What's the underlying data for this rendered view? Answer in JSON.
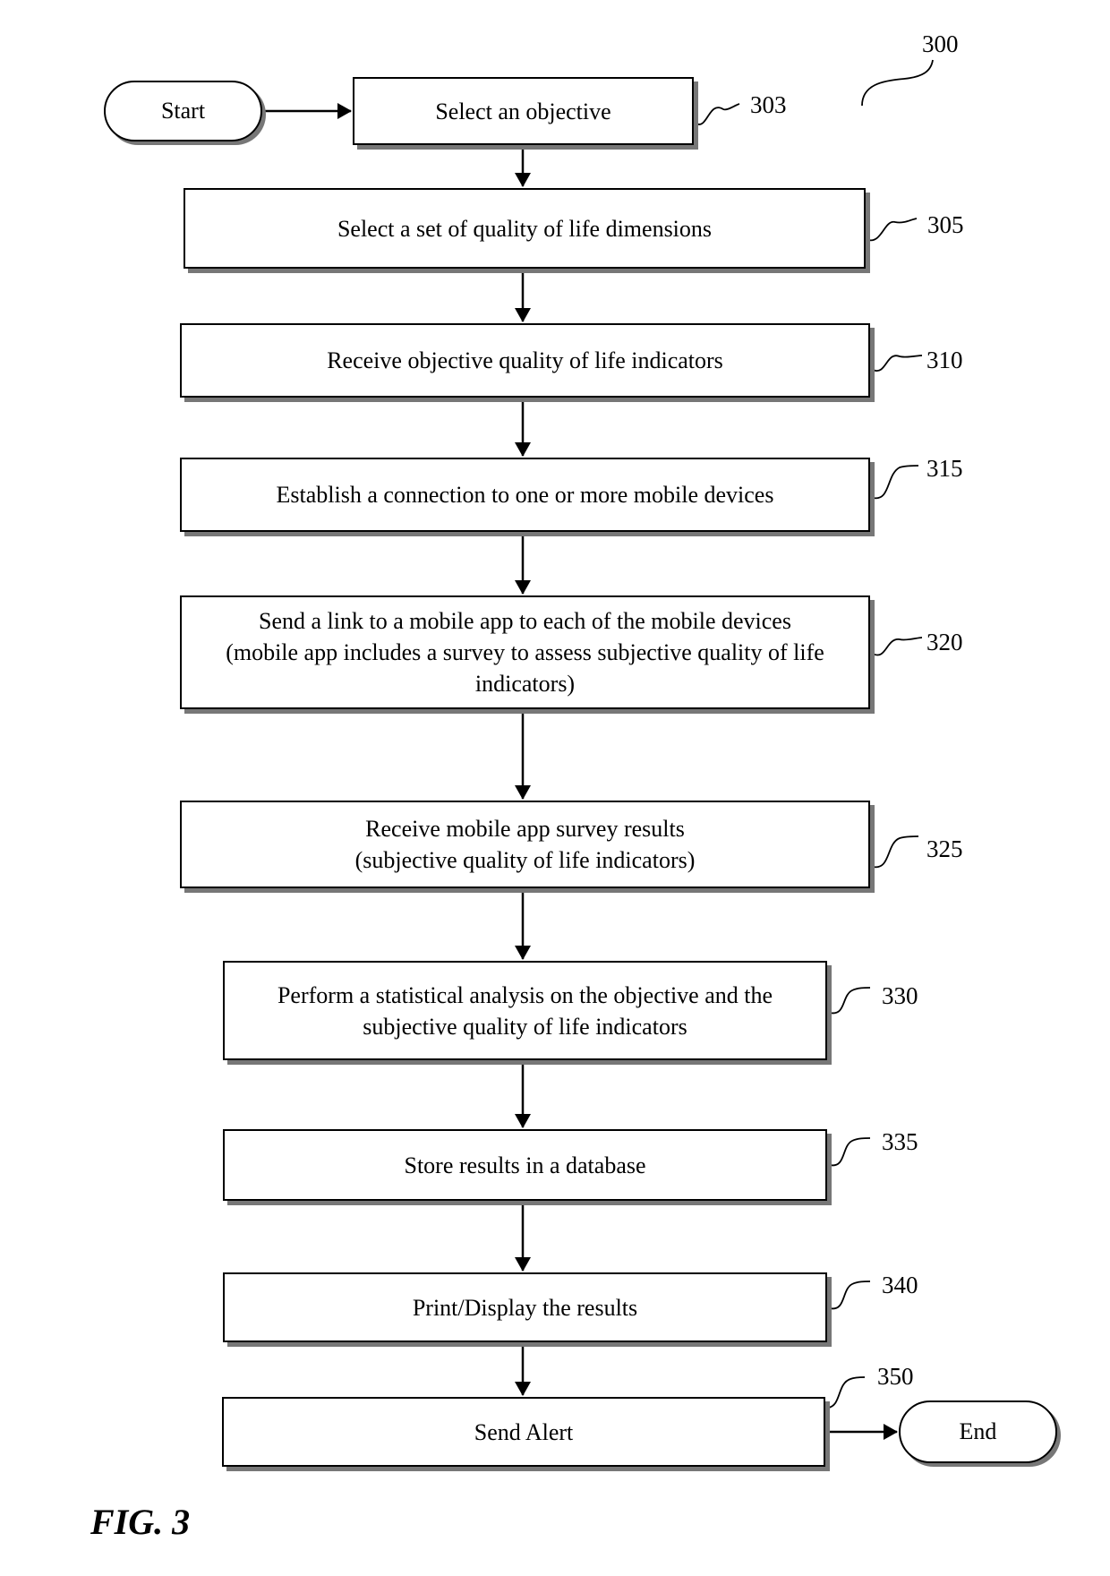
{
  "figure": {
    "label": "FIG. 3",
    "reference": "300"
  },
  "terminals": {
    "start": "Start",
    "end": "End"
  },
  "steps": [
    {
      "ref": "303",
      "lines": [
        "Select an objective"
      ]
    },
    {
      "ref": "305",
      "lines": [
        "Select a set of quality of life dimensions"
      ]
    },
    {
      "ref": "310",
      "lines": [
        "Receive objective quality of life indicators"
      ]
    },
    {
      "ref": "315",
      "lines": [
        "Establish a connection to one or more mobile devices"
      ]
    },
    {
      "ref": "320",
      "lines": [
        "Send a link to a mobile app to each of the mobile devices",
        "(mobile app includes a survey to assess subjective quality of life",
        "indicators)"
      ]
    },
    {
      "ref": "325",
      "lines": [
        "Receive mobile app survey results",
        "(subjective quality of life indicators)"
      ]
    },
    {
      "ref": "330",
      "lines": [
        "Perform a statistical analysis on the objective and the",
        "subjective quality of life indicators"
      ]
    },
    {
      "ref": "335",
      "lines": [
        "Store results in a database"
      ]
    },
    {
      "ref": "340",
      "lines": [
        "Print/Display the results"
      ]
    },
    {
      "ref": "350",
      "lines": [
        "Send Alert"
      ]
    }
  ]
}
